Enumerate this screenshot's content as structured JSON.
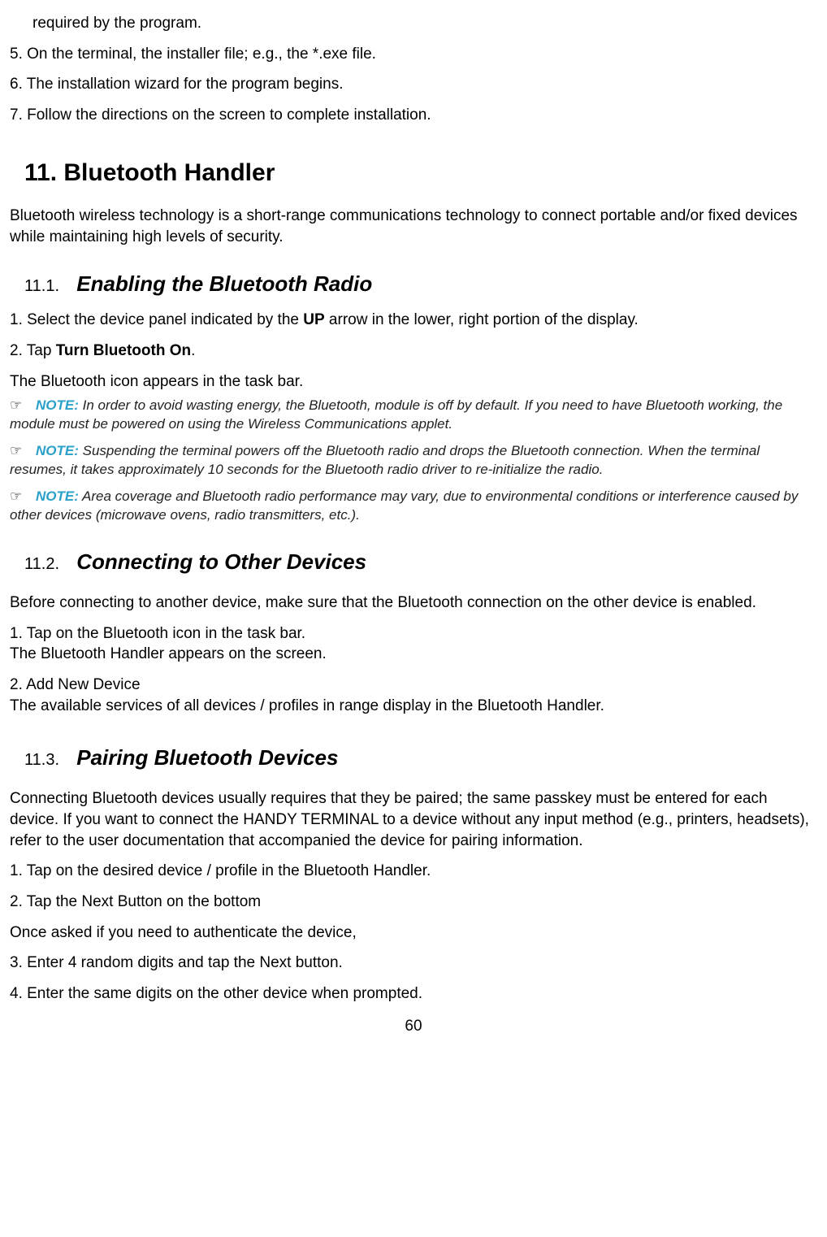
{
  "intro": {
    "line0": "required by the program.",
    "line5": "5. On the terminal, the installer file; e.g., the *.exe file.",
    "line6": "6. The installation wizard for the program begins.",
    "line7": "7. Follow the directions on the screen to complete installation."
  },
  "section11": {
    "title": "11.  Bluetooth Handler",
    "intro": "Bluetooth wireless technology is a short-range communications technology to connect portable and/or fixed devices while maintaining high levels of security."
  },
  "s11_1": {
    "num": "11.1.",
    "title": "Enabling the Bluetooth Radio",
    "step1_a": "1. Select the device panel indicated by the ",
    "step1_bold": "UP",
    "step1_b": " arrow in the lower, right portion of the display.",
    "step2_a": "2. Tap ",
    "step2_bold": "Turn Bluetooth On",
    "step2_b": ".",
    "after": "The Bluetooth icon appears in the task bar.",
    "notes": [
      "In order to avoid wasting energy, the Bluetooth, module is off by default. If you need to have Bluetooth working, the module must be powered on using the Wireless Communications applet.",
      "Suspending the terminal powers off the Bluetooth radio and drops the Bluetooth connection. When the terminal resumes, it takes approximately 10 seconds for the Bluetooth radio driver to re-initialize the radio.",
      "Area coverage and Bluetooth radio performance may vary, due to environmental conditions or interference caused by other devices (microwave ovens, radio transmitters, etc.)."
    ],
    "note_label": "NOTE:",
    "hand": "☞"
  },
  "s11_2": {
    "num": "11.2.",
    "title": "Connecting to Other Devices",
    "intro": "Before connecting to another device, make sure that the Bluetooth connection on the other device is enabled.",
    "step1a": "1. Tap on the Bluetooth icon in the task bar.",
    "step1b": "The Bluetooth Handler appears on the screen.",
    "step2a": "2.   Add New Device",
    "step2b": "The available services of all devices / profiles in range display in the Bluetooth Handler."
  },
  "s11_3": {
    "num": "11.3.",
    "title": "Pairing Bluetooth Devices",
    "intro": "Connecting Bluetooth devices usually requires that they be paired; the same passkey must be entered for each device. If you want to connect the HANDY TERMINAL to a device without any input method (e.g., printers, headsets), refer to the user documentation that accompanied the device for pairing information.",
    "step1": "1. Tap on the desired device / profile in the Bluetooth Handler.",
    "step2": "2. Tap the Next Button on the bottom",
    "after2": "Once asked if you need to authenticate the device,",
    "step3": "3. Enter 4 random digits and tap the Next button.",
    "step4": "4. Enter the same digits on the other device when prompted."
  },
  "page_number": "60"
}
